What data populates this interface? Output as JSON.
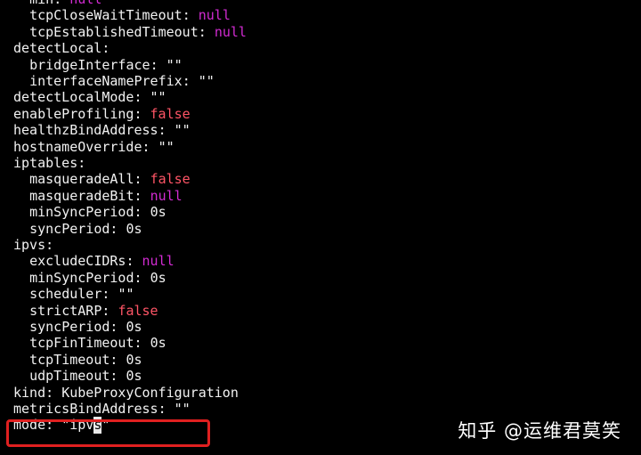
{
  "terminal": {
    "lines": [
      {
        "indent": 2,
        "key": "min",
        "value": "null",
        "type": "null"
      },
      {
        "indent": 2,
        "key": "tcpCloseWaitTimeout",
        "value": "null",
        "type": "null"
      },
      {
        "indent": 2,
        "key": "tcpEstablishedTimeout",
        "value": "null",
        "type": "null"
      },
      {
        "indent": 0,
        "key": "detectLocal",
        "value": "",
        "type": "section"
      },
      {
        "indent": 2,
        "key": "bridgeInterface",
        "value": "\"\"",
        "type": "str"
      },
      {
        "indent": 2,
        "key": "interfaceNamePrefix",
        "value": "\"\"",
        "type": "str"
      },
      {
        "indent": 0,
        "key": "detectLocalMode",
        "value": "\"\"",
        "type": "str"
      },
      {
        "indent": 0,
        "key": "enableProfiling",
        "value": "false",
        "type": "false"
      },
      {
        "indent": 0,
        "key": "healthzBindAddress",
        "value": "\"\"",
        "type": "str"
      },
      {
        "indent": 0,
        "key": "hostnameOverride",
        "value": "\"\"",
        "type": "str"
      },
      {
        "indent": 0,
        "key": "iptables",
        "value": "",
        "type": "section"
      },
      {
        "indent": 2,
        "key": "masqueradeAll",
        "value": "false",
        "type": "false"
      },
      {
        "indent": 2,
        "key": "masqueradeBit",
        "value": "null",
        "type": "null"
      },
      {
        "indent": 2,
        "key": "minSyncPeriod",
        "value": "0s",
        "type": "str"
      },
      {
        "indent": 2,
        "key": "syncPeriod",
        "value": "0s",
        "type": "str"
      },
      {
        "indent": 0,
        "key": "ipvs",
        "value": "",
        "type": "section"
      },
      {
        "indent": 2,
        "key": "excludeCIDRs",
        "value": "null",
        "type": "null"
      },
      {
        "indent": 2,
        "key": "minSyncPeriod",
        "value": "0s",
        "type": "str"
      },
      {
        "indent": 2,
        "key": "scheduler",
        "value": "\"\"",
        "type": "str"
      },
      {
        "indent": 2,
        "key": "strictARP",
        "value": "false",
        "type": "false"
      },
      {
        "indent": 2,
        "key": "syncPeriod",
        "value": "0s",
        "type": "str"
      },
      {
        "indent": 2,
        "key": "tcpFinTimeout",
        "value": "0s",
        "type": "str"
      },
      {
        "indent": 2,
        "key": "tcpTimeout",
        "value": "0s",
        "type": "str"
      },
      {
        "indent": 2,
        "key": "udpTimeout",
        "value": "0s",
        "type": "str"
      },
      {
        "indent": 0,
        "key": "kind",
        "value": "KubeProxyConfiguration",
        "type": "str"
      },
      {
        "indent": 0,
        "key": "metricsBindAddress",
        "value": "\"\"",
        "type": "str"
      },
      {
        "indent": 0,
        "key": "mode",
        "value_before_cursor": "\"ipv",
        "cursor_char": "s",
        "value_after_cursor": "\"",
        "type": "cursor"
      }
    ]
  },
  "colors": {
    "background": "#000000",
    "text": "#f2f2f2",
    "null": "#d22bd2",
    "false": "#ff5566",
    "highlight_box": "#e02020"
  },
  "watermark": {
    "text": "知乎 @运维君莫笑"
  }
}
